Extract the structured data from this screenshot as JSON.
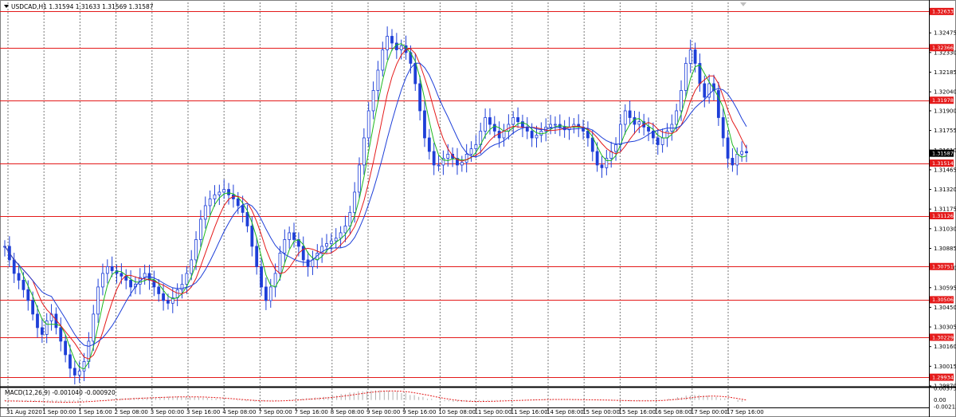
{
  "header": {
    "symbol_line": "USDCAD,H1  1.31594 1.31633 1.31569 1.31587",
    "macd_label": "MACD(12,26,9) -0.001040 -0.000920"
  },
  "colors": {
    "up_candle": "#1E3FD8",
    "level_line": "#E41A1A",
    "level_box": "#E41A1A",
    "ma_fast": "#1DB81D",
    "ma_mid": "#E41A1A",
    "ma_slow": "#1E3FD8",
    "macd_hist": "#B0B0B0",
    "macd_signal": "#E41A1A",
    "grid": "#7A7A7A",
    "current_box": "#000000"
  },
  "chart_data": {
    "type": "candlestick",
    "ylim": [
      1.2987,
      1.327
    ],
    "price_ticks": [
      "1.32475",
      "1.32330",
      "1.32185",
      "1.32040",
      "1.31900",
      "1.31755",
      "1.31610",
      "1.31465",
      "1.31320",
      "1.31175",
      "1.31030",
      "1.30885",
      "1.30740",
      "1.30595",
      "1.30450",
      "1.30305",
      "1.30160",
      "1.30015",
      "1.29870"
    ],
    "price_tick_values": [
      1.32475,
      1.3233,
      1.32185,
      1.3204,
      1.319,
      1.31755,
      1.3161,
      1.31465,
      1.3132,
      1.31175,
      1.3103,
      1.30885,
      1.3074,
      1.30595,
      1.3045,
      1.30305,
      1.3016,
      1.30015,
      1.2987
    ],
    "levels": [
      {
        "label": "1.32633",
        "value": 1.32633
      },
      {
        "label": "1.32366",
        "value": 1.32366
      },
      {
        "label": "1.31978",
        "value": 1.31978
      },
      {
        "label": "1.31514",
        "value": 1.31514
      },
      {
        "label": "1.31126",
        "value": 1.31126
      },
      {
        "label": "1.30751",
        "value": 1.30751
      },
      {
        "label": "1.30506",
        "value": 1.30506
      },
      {
        "label": "1.30229",
        "value": 1.30229
      },
      {
        "label": "1.29934",
        "value": 1.29934
      }
    ],
    "current_price": {
      "label": "1.31587",
      "value": 1.31587
    },
    "time_labels": [
      "31 Aug 2020",
      "1 Sep 00:00",
      "1 Sep 16:00",
      "2 Sep 08:00",
      "3 Sep 00:00",
      "3 Sep 16:00",
      "4 Sep 08:00",
      "7 Sep 00:00",
      "7 Sep 16:00",
      "8 Sep 08:00",
      "9 Sep 00:00",
      "9 Sep 16:00",
      "10 Sep 08:00",
      "11 Sep 00:00",
      "11 Sep 16:00",
      "14 Sep 08:00",
      "15 Sep 00:00",
      "15 Sep 16:00",
      "16 Sep 08:00",
      "17 Sep 00:00",
      "17 Sep 16:00"
    ],
    "closes": [
      1.309,
      1.308,
      1.307,
      1.3065,
      1.3058,
      1.305,
      1.304,
      1.303,
      1.3025,
      1.3035,
      1.304,
      1.303,
      1.302,
      1.301,
      1.3,
      1.2995,
      1.2998,
      1.3005,
      1.302,
      1.304,
      1.306,
      1.307,
      1.3075,
      1.3072,
      1.307,
      1.3068,
      1.3065,
      1.306,
      1.3062,
      1.3067,
      1.307,
      1.3065,
      1.306,
      1.3055,
      1.305,
      1.3048,
      1.3052,
      1.3058,
      1.3062,
      1.307,
      1.308,
      1.3095,
      1.311,
      1.312,
      1.3125,
      1.3128,
      1.313,
      1.3132,
      1.3128,
      1.3125,
      1.312,
      1.3115,
      1.3105,
      1.309,
      1.3075,
      1.306,
      1.305,
      1.306,
      1.307,
      1.3085,
      1.3095,
      1.31,
      1.3095,
      1.309,
      1.308,
      1.3075,
      1.308,
      1.3085,
      1.309,
      1.3092,
      1.3094,
      1.3096,
      1.31,
      1.3105,
      1.3115,
      1.313,
      1.315,
      1.317,
      1.319,
      1.3205,
      1.322,
      1.3235,
      1.3245,
      1.324,
      1.3235,
      1.3238,
      1.3233,
      1.3225,
      1.321,
      1.319,
      1.317,
      1.316,
      1.315,
      1.315,
      1.3155,
      1.3158,
      1.3155,
      1.315,
      1.3152,
      1.3158,
      1.3162,
      1.3165,
      1.3175,
      1.3185,
      1.318,
      1.3175,
      1.317,
      1.3175,
      1.318,
      1.3185,
      1.3182,
      1.3178,
      1.3175,
      1.317,
      1.3172,
      1.3175,
      1.3178,
      1.318,
      1.318,
      1.3178,
      1.3176,
      1.3178,
      1.318,
      1.3178,
      1.3175,
      1.317,
      1.316,
      1.315,
      1.3148,
      1.3155,
      1.316,
      1.3165,
      1.318,
      1.319,
      1.3185,
      1.318,
      1.3182,
      1.3178,
      1.3175,
      1.317,
      1.3165,
      1.317,
      1.3175,
      1.318,
      1.319,
      1.3205,
      1.3225,
      1.3235,
      1.3225,
      1.321,
      1.32,
      1.321,
      1.3205,
      1.3185,
      1.317,
      1.3155,
      1.315,
      1.3158,
      1.316,
      1.3159
    ],
    "macd_hist": [
      -0.0003,
      -0.0004,
      -0.0005,
      -0.0006,
      -0.0007,
      -0.0008,
      -0.0008,
      -0.0007,
      -0.0005,
      -0.0003,
      -0.0001,
      0.0001,
      0.0003,
      0.0005,
      0.0006,
      0.0007,
      0.0008,
      0.0009,
      0.001,
      0.0011,
      0.0011,
      0.001,
      0.0009,
      0.0007,
      0.0005,
      0.0003,
      0.0001,
      -0.0002,
      -0.0004,
      -0.0005,
      -0.0004,
      -0.0002,
      0.0,
      0.0002,
      0.0004,
      0.0006,
      0.0008,
      0.001,
      0.0014,
      0.0019,
      0.0024,
      0.0028,
      0.003,
      0.0031,
      0.003,
      0.0027,
      0.0022,
      0.0016,
      0.001,
      0.0004,
      -0.0001,
      -0.0004,
      -0.0006,
      -0.0006,
      -0.0005,
      -0.0004,
      -0.0003,
      -0.0002,
      -0.0001,
      0.0,
      0.0001,
      0.0002,
      0.0002,
      0.0002,
      0.0001,
      0.0001,
      0.0001,
      0.0,
      0.0,
      -0.0001,
      -0.0002,
      -0.0003,
      -0.0004,
      -0.0003,
      -0.0002,
      -0.0001,
      0.0001,
      0.0004,
      0.0009,
      0.0014,
      0.0016,
      0.0014,
      0.001,
      0.0005,
      0.0,
      -0.0006,
      -0.001
    ],
    "macd_ylim": [
      -0.002135,
      0.003755
    ],
    "macd_ticks": [
      "0.003755",
      "0.00",
      "-0.002135"
    ],
    "macd_tick_values": [
      0.003755,
      0.0,
      -0.002135
    ]
  }
}
